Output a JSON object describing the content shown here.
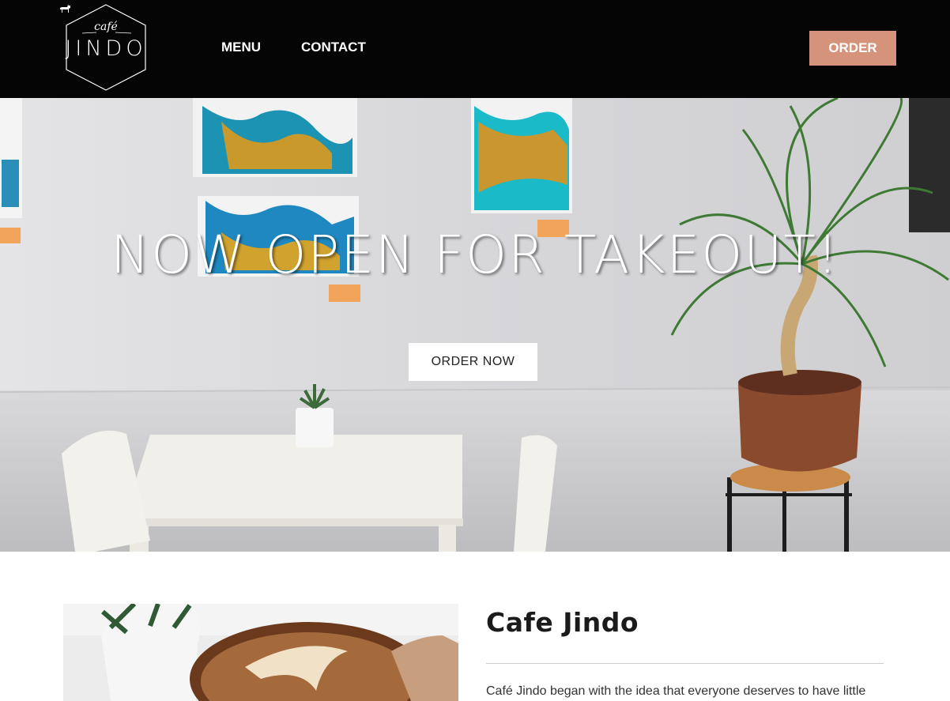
{
  "header": {
    "logo": {
      "small_text": "café",
      "name": "JINDO"
    },
    "nav": [
      {
        "label": "MENU"
      },
      {
        "label": "CONTACT"
      }
    ],
    "order_button": "ORDER"
  },
  "hero": {
    "title": "NOW OPEN FOR TAKEOUT!",
    "cta": "ORDER NOW"
  },
  "about": {
    "title": "Cafe Jindo",
    "text": "Café Jindo began with the idea that everyone deserves to have little"
  },
  "colors": {
    "header_bg": "#050505",
    "accent": "#d4937a",
    "text": "#222222"
  }
}
